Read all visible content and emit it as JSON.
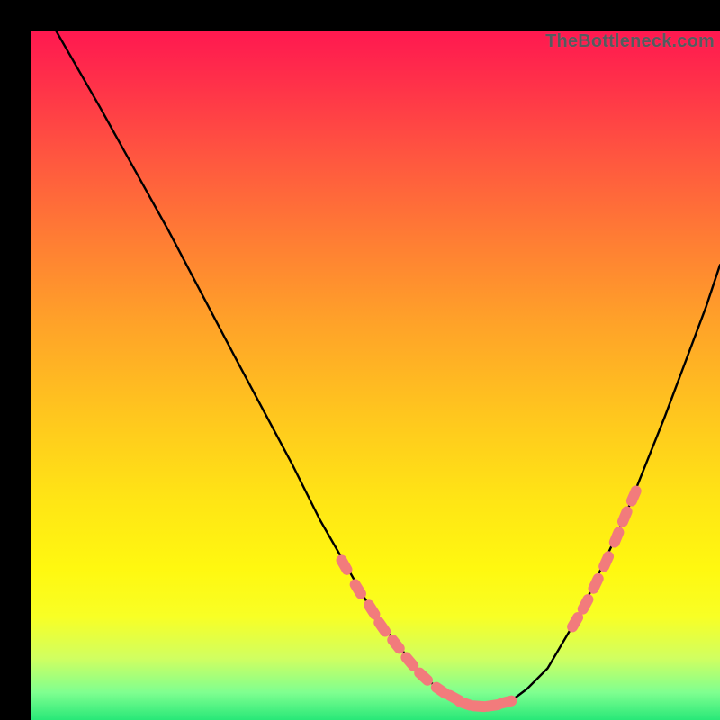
{
  "watermark": "TheBottleneck.com",
  "chart_data": {
    "type": "line",
    "title": "",
    "xlabel": "",
    "ylabel": "",
    "xlim": [
      0,
      100
    ],
    "ylim": [
      0,
      100
    ],
    "series": [
      {
        "name": "bottleneck-curve",
        "x": [
          3.1,
          10,
          20,
          30,
          38,
          42,
          46,
          50,
          54,
          56,
          58,
          60,
          62,
          64,
          66,
          68,
          70,
          72,
          75,
          80,
          86,
          92,
          98,
          100
        ],
        "y": [
          101,
          89,
          71,
          52,
          37,
          29,
          22,
          15,
          10,
          7.5,
          5.5,
          4,
          3,
          2.3,
          2,
          2.2,
          3,
          4.5,
          7.5,
          16,
          29,
          44,
          60,
          66
        ]
      }
    ],
    "markers": [
      {
        "name": "marker-left",
        "x": [
          45.5,
          47.5,
          49.5,
          51,
          53,
          55,
          57,
          59.5,
          61.5,
          63,
          65,
          67,
          69
        ],
        "y": [
          22.5,
          19,
          16,
          13.5,
          11,
          8.5,
          6.3,
          4.3,
          3.2,
          2.4,
          2.0,
          2.1,
          2.6
        ]
      },
      {
        "name": "marker-right",
        "x": [
          79,
          80.5,
          82,
          83.5,
          85,
          86.2,
          87.5
        ],
        "y": [
          14.2,
          16.8,
          19.8,
          23,
          26.5,
          29.5,
          32.5
        ]
      }
    ],
    "colors": {
      "curve": "#000000",
      "marker": "#f27b7c"
    }
  }
}
